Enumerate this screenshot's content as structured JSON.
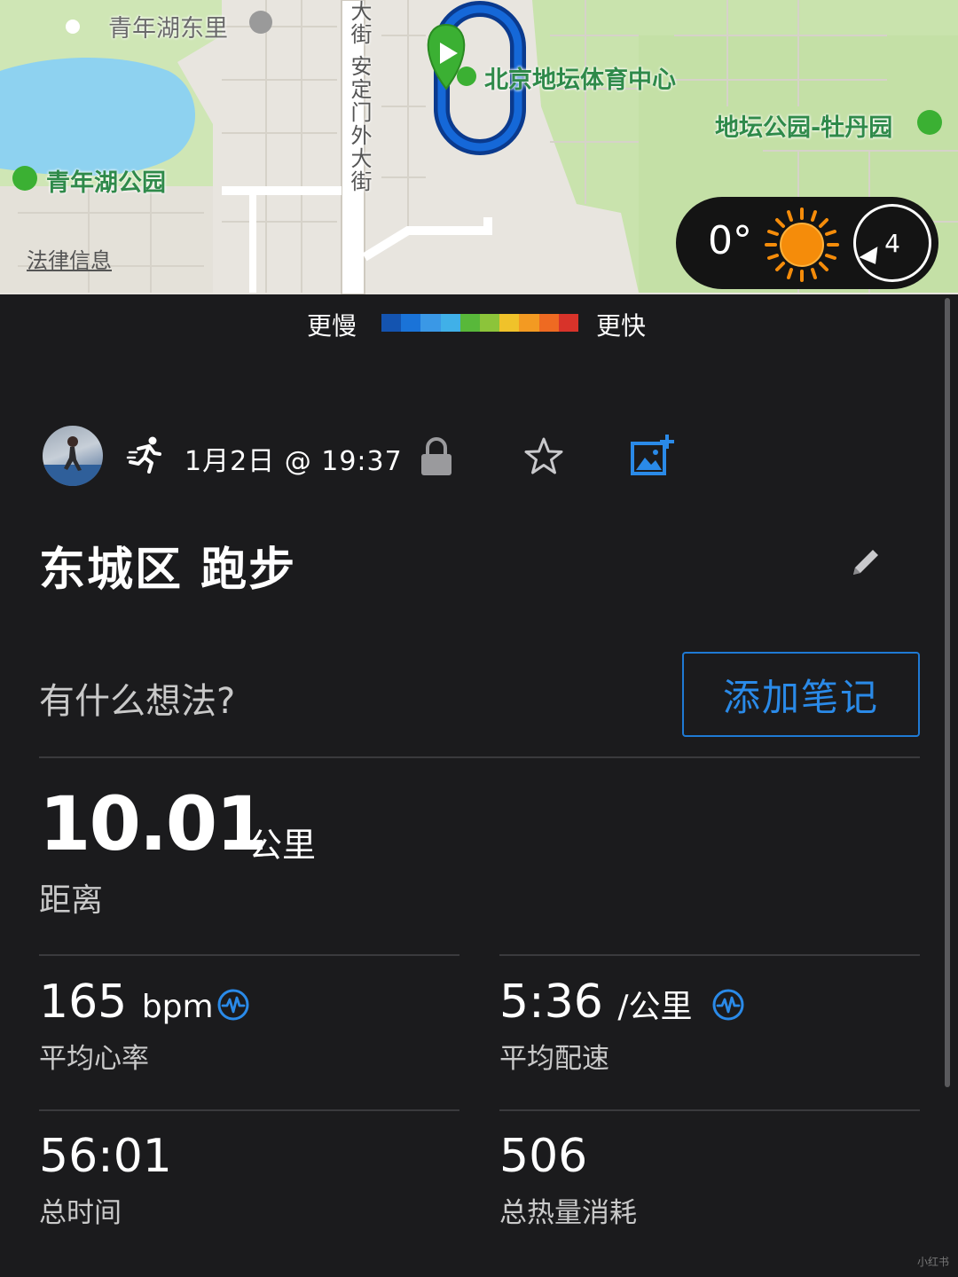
{
  "map": {
    "labels": {
      "qingnianhu_dongli": "青年湖东里",
      "street_fragment": "大街",
      "andingmen_street": "安定门外大街",
      "ditan_sports_center": "北京地坛体育中心",
      "ditan_park": "地坛公园-牡丹园",
      "qingnianhu_park": "青年湖公园"
    },
    "legal_link": "法律信息",
    "weather": {
      "temperature": "0°",
      "wind_speed": "4",
      "icon": "sun-icon"
    }
  },
  "legend": {
    "slower": "更慢",
    "faster": "更快",
    "colors": [
      "#1454b0",
      "#1a73d8",
      "#3a98e6",
      "#40b0e8",
      "#58b83a",
      "#8cc43a",
      "#f0c22a",
      "#f39a22",
      "#ee6a22",
      "#d8332a"
    ]
  },
  "activity": {
    "date": "1月2日 @ 19:37",
    "title": "东城区 跑步",
    "note_prompt": "有什么想法?",
    "add_note_label": "添加笔记",
    "icons": [
      "avatar",
      "run-icon",
      "lock-icon",
      "star-icon",
      "add-photo-icon",
      "edit-icon"
    ]
  },
  "stats": {
    "distance": {
      "value": "10.01",
      "unit": "公里",
      "label": "距离"
    },
    "avg_hr": {
      "value": "165",
      "unit": "bpm",
      "label": "平均心率"
    },
    "avg_pace": {
      "value": "5:36",
      "unit": "/公里",
      "label": "平均配速"
    },
    "total_time": {
      "value": "56:01",
      "label": "总时间"
    },
    "calories": {
      "value": "506",
      "label": "总热量消耗"
    }
  },
  "colors": {
    "accent": "#2a8ae8",
    "background": "#1b1b1d",
    "route": "#0a56c8",
    "start_marker": "#3bb033"
  },
  "watermark": "小红书"
}
